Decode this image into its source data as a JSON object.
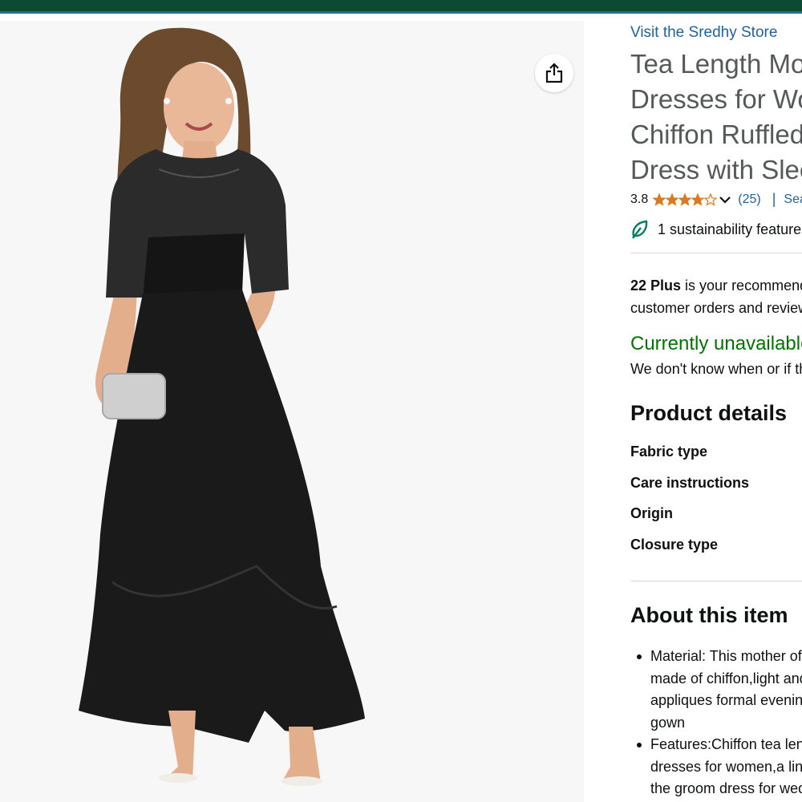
{
  "store": {
    "link_label": "Visit the Sredhy Store"
  },
  "product": {
    "title_lines": [
      "Tea Length Mother of the Bride",
      "Dresses for Women Lace",
      "Chiffon Ruffled Formal Evening",
      "Dress with Sleeves"
    ],
    "rating": "3.8",
    "stars_filled": 3.8,
    "stars_total": 5,
    "rating_count": "(25)",
    "rating_separator": "|",
    "search_link": "Search this page",
    "sustainability": "1 sustainability feature"
  },
  "recommendation": {
    "size": "22 Plus",
    "line1_rest": " is your recommended size",
    "line2": "customer orders and reviews"
  },
  "availability": {
    "status": "Currently unavailable.",
    "note": "We don't know when or if this item will be back in stock."
  },
  "product_details": {
    "heading": "Product details",
    "labels": [
      "Fabric type",
      "Care instructions",
      "Origin",
      "Closure type"
    ]
  },
  "about": {
    "heading": "About this item",
    "bullets": [
      [
        "Material: This mother of the bride dress is",
        "made of chiffon,light and soft with lace",
        "appliques formal evening dresses a line",
        "gown"
      ],
      [
        "Features:Chiffon tea length mother of the bride",
        "dresses for women,a line mother of",
        "the groom dress for wedding guest"
      ]
    ]
  },
  "colors": {
    "topbar": "#0b4a33",
    "link": "#2162a1",
    "available_green": "#007600",
    "star": "#de7921",
    "title_gray": "#565959"
  },
  "icons": {
    "share": "share-icon",
    "star": "star-icon",
    "chevron": "chevron-down-icon",
    "leaf": "leaf-icon"
  }
}
